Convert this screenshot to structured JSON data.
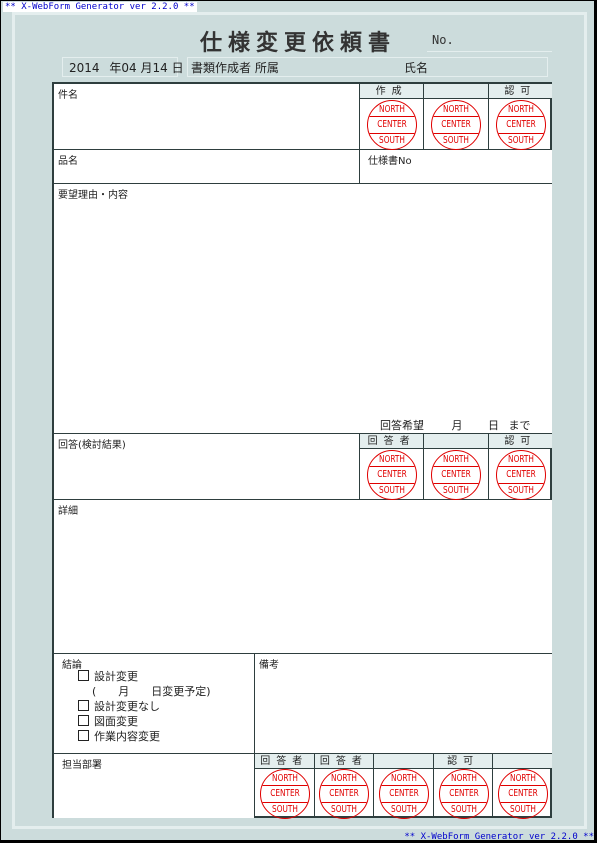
{
  "banner": {
    "top": "** X-WebForm Generator ver 2.2.0 **",
    "bottom": "** X-WebForm Generator ver 2.2.0 **"
  },
  "header": {
    "title": "仕様変更依頼書",
    "no_label": "No.",
    "date": {
      "year": "2014",
      "year_unit": "年",
      "month": "04",
      "month_unit": "月",
      "day": "14",
      "day_unit": "日"
    },
    "author_affiliation_label": "書類作成者 所属",
    "author_name_label": "氏名"
  },
  "sections": {
    "subject": {
      "label": "件名"
    },
    "product": {
      "label": "品名"
    },
    "spec_no": {
      "label": "仕様書No"
    },
    "request": {
      "label": "要望理由・内容"
    },
    "reply_hope": {
      "label": "回答希望",
      "month_unit": "月",
      "day_unit": "日",
      "until": "まで"
    },
    "reply": {
      "label": "回答(検討結果)"
    },
    "detail": {
      "label": "詳細"
    },
    "conclusion": {
      "label": "結論",
      "options": [
        {
          "label": "設計変更",
          "checked": false
        },
        {
          "label": "設計変更なし",
          "checked": false
        },
        {
          "label": "図面変更",
          "checked": false
        },
        {
          "label": "作業内容変更",
          "checked": false
        }
      ],
      "schedule_text": "(　　月　　日変更予定)"
    },
    "remarks": {
      "label": "備考"
    },
    "department": {
      "label": "担当部署"
    }
  },
  "approval_top": {
    "headers": [
      "作成",
      "",
      "認可"
    ]
  },
  "approval_reply": {
    "headers": [
      "回答者",
      "",
      "認可"
    ]
  },
  "approval_bottom": {
    "headers": [
      "回答者",
      "回答者",
      "",
      "認可",
      ""
    ]
  },
  "stamp": {
    "line1": "NORTH",
    "line2": "CENTER",
    "line3": "SOUTH",
    "color": "#e00000"
  }
}
